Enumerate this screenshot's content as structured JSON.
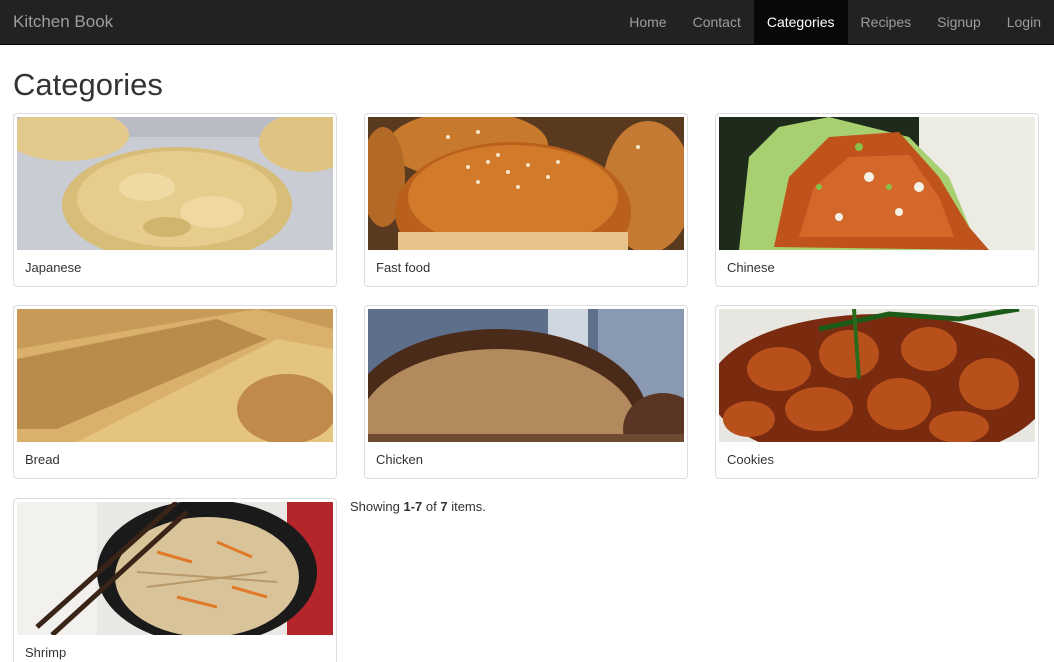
{
  "brand": "Kitchen Book",
  "nav": {
    "home": "Home",
    "contact": "Contact",
    "categories": "Categories",
    "recipes": "Recipes",
    "signup": "Signup",
    "login": "Login"
  },
  "page_title": "Categories",
  "categories": [
    {
      "name": "Japanese"
    },
    {
      "name": "Fast food"
    },
    {
      "name": "Chinese"
    },
    {
      "name": "Bread"
    },
    {
      "name": "Chicken"
    },
    {
      "name": "Cookies"
    },
    {
      "name": "Shrimp"
    }
  ],
  "summary": {
    "prefix": "Showing ",
    "range": "1-7",
    "of": " of ",
    "total": "7",
    "suffix": " items."
  },
  "colors": {
    "navbar_bg": "#222222",
    "nav_text": "#9d9d9d",
    "nav_active_bg": "#080808"
  }
}
